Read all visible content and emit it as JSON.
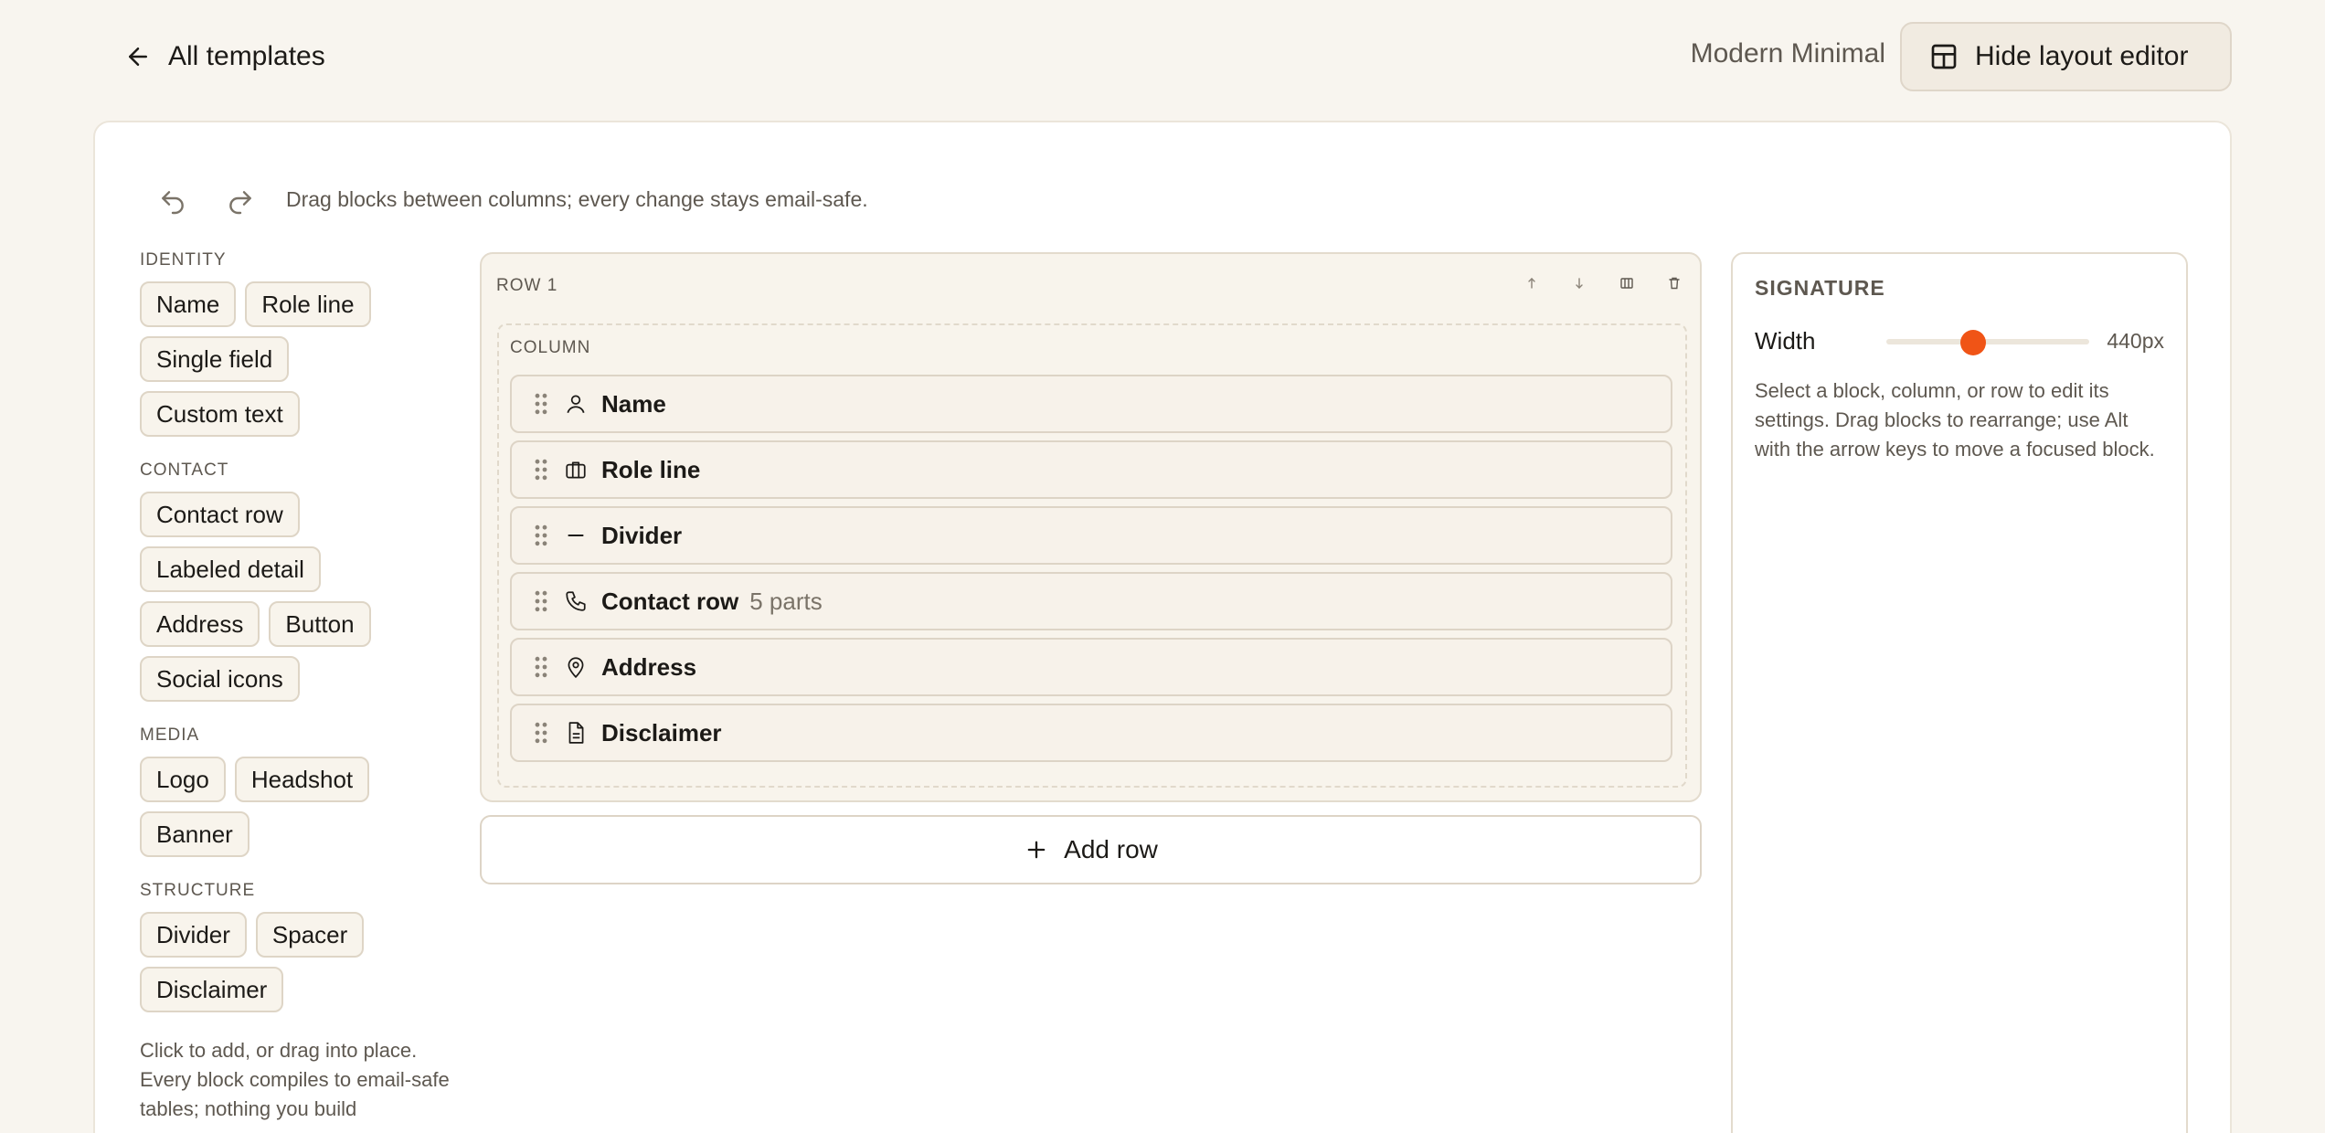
{
  "header": {
    "back_label": "All templates",
    "template_name": "Modern Minimal",
    "toggle_editor_label": "Hide layout editor"
  },
  "toolbar": {
    "hint": "Drag blocks between columns; every change stays email-safe."
  },
  "palette": {
    "groups": [
      {
        "title": "IDENTITY",
        "items": [
          "Name",
          "Role line",
          "Single field",
          "Custom text"
        ]
      },
      {
        "title": "CONTACT",
        "items": [
          "Contact row",
          "Labeled detail",
          "Address",
          "Button",
          "Social icons"
        ]
      },
      {
        "title": "MEDIA",
        "items": [
          "Logo",
          "Headshot",
          "Banner"
        ]
      },
      {
        "title": "STRUCTURE",
        "items": [
          "Divider",
          "Spacer",
          "Disclaimer"
        ]
      }
    ],
    "note": "Click to add, or drag into place. Every block compiles to email-safe tables; nothing you build"
  },
  "canvas": {
    "row_title": "ROW 1",
    "column_title": "COLUMN",
    "blocks": [
      {
        "label": "Name",
        "icon": "user-icon",
        "sub": ""
      },
      {
        "label": "Role line",
        "icon": "briefcase-icon",
        "sub": ""
      },
      {
        "label": "Divider",
        "icon": "divider-icon",
        "sub": ""
      },
      {
        "label": "Contact row",
        "icon": "phone-icon",
        "sub": "5 parts"
      },
      {
        "label": "Address",
        "icon": "map-pin-icon",
        "sub": ""
      },
      {
        "label": "Disclaimer",
        "icon": "document-icon",
        "sub": ""
      }
    ],
    "add_row_label": "Add row"
  },
  "settings": {
    "title": "SIGNATURE",
    "width_label": "Width",
    "width_value": "440px",
    "width_fraction": 0.43,
    "help": "Select a block, column, or row to edit its settings. Drag blocks to rearrange; use Alt with the arrow keys to move a focused block."
  },
  "colors": {
    "accent": "#f05416",
    "background": "#f8f5ef",
    "surface": "#ffffff",
    "chip_bg": "#f8f4ec",
    "border": "#ddd4c6"
  }
}
